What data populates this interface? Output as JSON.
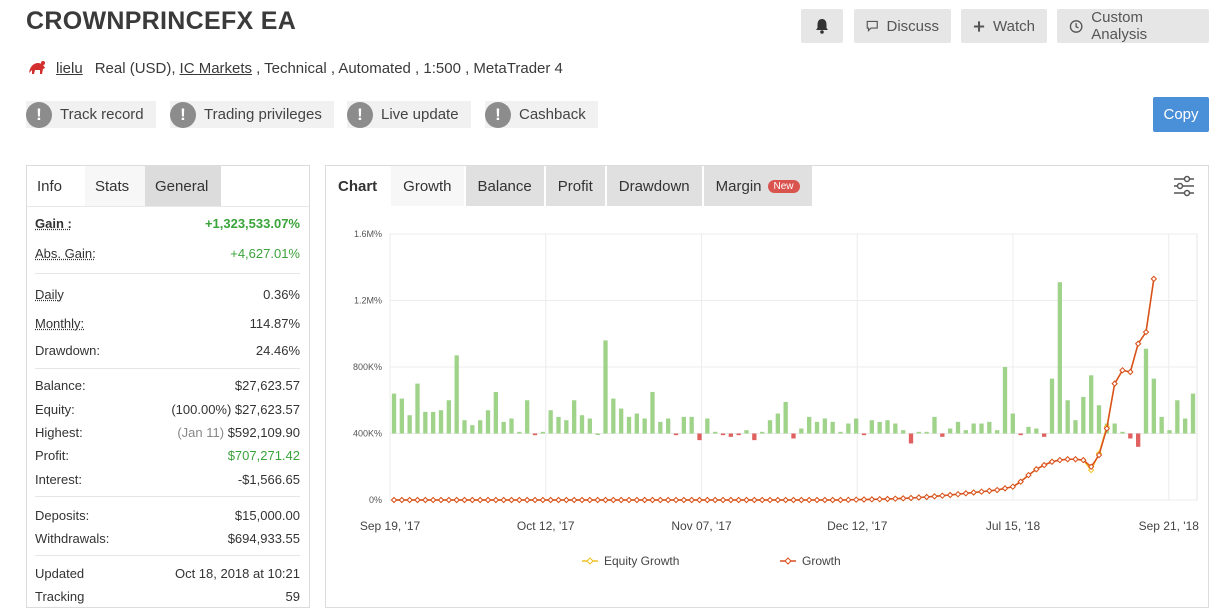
{
  "header": {
    "title": "CROWNPRINCEFX EA",
    "discuss_label": "Discuss",
    "watch_label": "Watch",
    "analysis_label": "Custom Analysis"
  },
  "meta": {
    "user": "lielu",
    "account_prefix": "Real (USD),",
    "broker": "IC Markets",
    "account_suffix": ", Technical , Automated , 1:500 , MetaTrader 4"
  },
  "badges": [
    "Track record",
    "Trading privileges",
    "Live update",
    "Cashback"
  ],
  "copy_label": "Copy",
  "left_tabs": [
    "Info",
    "Stats",
    "General"
  ],
  "stats": {
    "gain": {
      "label": "Gain :",
      "value": "+1,323,533.07%"
    },
    "abs_gain": {
      "label": "Abs. Gain:",
      "value": "+4,627.01%"
    },
    "daily": {
      "label": "Daily",
      "value": "0.36%"
    },
    "monthly": {
      "label": "Monthly:",
      "value": "114.87%"
    },
    "drawdown": {
      "label": "Drawdown:",
      "value": "24.46%"
    },
    "balance": {
      "label": "Balance:",
      "value": "$27,623.57"
    },
    "equity": {
      "label": "Equity:",
      "value": "(100.00%) $27,623.57"
    },
    "highest": {
      "label": "Highest:",
      "date": "(Jan 11)",
      "value": "$592,109.90"
    },
    "profit": {
      "label": "Profit:",
      "value": "$707,271.42"
    },
    "interest": {
      "label": "Interest:",
      "value": "-$1,566.65"
    },
    "deposits": {
      "label": "Deposits:",
      "value": "$15,000.00"
    },
    "withdrawals": {
      "label": "Withdrawals:",
      "value": "$694,933.55"
    },
    "updated": {
      "label": "Updated",
      "value": "Oct 18, 2018 at 10:21"
    },
    "tracking": {
      "label": "Tracking",
      "value": "59"
    }
  },
  "chart_tabs": [
    "Chart",
    "Growth",
    "Balance",
    "Profit",
    "Drawdown",
    "Margin"
  ],
  "new_badge": "New",
  "colors": {
    "accent": "#4a90d9",
    "positive": "#3aa33a",
    "bar_positive": "#9fd38a",
    "bar_negative": "#e06060",
    "growth_line": "#d84f20",
    "equity_line": "#f0c020"
  },
  "chart_data": {
    "type": "bar+line",
    "y_ticks": [
      "0%",
      "400K%",
      "800K%",
      "1.2M%",
      "1.6M%"
    ],
    "ylim": [
      0,
      1600000
    ],
    "x_ticks": [
      "Sep 19, '17",
      "Oct 12, '17",
      "Nov 07, '17",
      "Dec 12, '17",
      "Jul 15, '18",
      "Sep 21, '18"
    ],
    "legend": [
      "Equity Growth",
      "Growth"
    ],
    "bar_baseline": 400000,
    "bars": [
      240000,
      210000,
      110000,
      300000,
      130000,
      130000,
      140000,
      200000,
      470000,
      80000,
      50000,
      80000,
      140000,
      250000,
      70000,
      90000,
      10000,
      200000,
      -10000,
      10000,
      140000,
      100000,
      80000,
      200000,
      110000,
      90000,
      0,
      560000,
      210000,
      150000,
      100000,
      120000,
      90000,
      250000,
      70000,
      90000,
      -10000,
      100000,
      100000,
      -40000,
      90000,
      10000,
      -10000,
      -20000,
      -10000,
      20000,
      -40000,
      10000,
      80000,
      120000,
      190000,
      -30000,
      30000,
      100000,
      70000,
      90000,
      70000,
      10000,
      60000,
      90000,
      -10000,
      80000,
      70000,
      80000,
      60000,
      20000,
      -60000,
      10000,
      10000,
      100000,
      -20000,
      30000,
      70000,
      20000,
      60000,
      60000,
      70000,
      20000,
      400000,
      120000,
      -10000,
      40000,
      30000,
      -20000,
      330000,
      910000,
      200000,
      80000,
      220000,
      350000,
      170000,
      60000,
      60000,
      10000,
      -30000,
      -80000,
      510000,
      330000,
      100000,
      20000,
      200000,
      90000,
      240000
    ],
    "growth": [
      0,
      0,
      0,
      0,
      0,
      0,
      0,
      0,
      0,
      0,
      0,
      0,
      0,
      0,
      0,
      0,
      0,
      0,
      0,
      0,
      0,
      0,
      0,
      0,
      0,
      0,
      0,
      0,
      0,
      0,
      0,
      0,
      0,
      0,
      0,
      0,
      0,
      0,
      0,
      0,
      0,
      0,
      0,
      0,
      0,
      0,
      0,
      0,
      0,
      0,
      0,
      0,
      0,
      0,
      0,
      0,
      0,
      0,
      1000,
      2000,
      3000,
      4000,
      5000,
      6000,
      8000,
      10000,
      12000,
      15000,
      18000,
      22000,
      26000,
      30000,
      35000,
      40000,
      45000,
      50000,
      55000,
      60000,
      70000,
      80000,
      110000,
      150000,
      185000,
      210000,
      230000,
      240000,
      245000,
      245000,
      240000,
      200000,
      270000,
      430000,
      700000,
      780000,
      770000,
      940000,
      1010000,
      1330000
    ],
    "equity": [
      0,
      0,
      0,
      0,
      0,
      0,
      0,
      0,
      0,
      0,
      0,
      0,
      0,
      0,
      0,
      0,
      0,
      0,
      0,
      0,
      0,
      0,
      0,
      0,
      0,
      0,
      0,
      0,
      0,
      0,
      0,
      0,
      0,
      0,
      0,
      0,
      0,
      0,
      0,
      0,
      0,
      0,
      0,
      0,
      0,
      0,
      0,
      0,
      0,
      0,
      0,
      0,
      0,
      0,
      0,
      0,
      0,
      0,
      1000,
      2000,
      3000,
      4000,
      5000,
      6000,
      8000,
      10000,
      12000,
      15000,
      18000,
      22000,
      26000,
      30000,
      35000,
      40000,
      45000,
      50000,
      55000,
      60000,
      70000,
      80000,
      110000,
      150000,
      185000,
      210000,
      230000,
      240000,
      245000,
      245000,
      240000,
      180000,
      280000,
      440000,
      700000,
      780000,
      770000,
      940000,
      1010000,
      1330000
    ]
  }
}
